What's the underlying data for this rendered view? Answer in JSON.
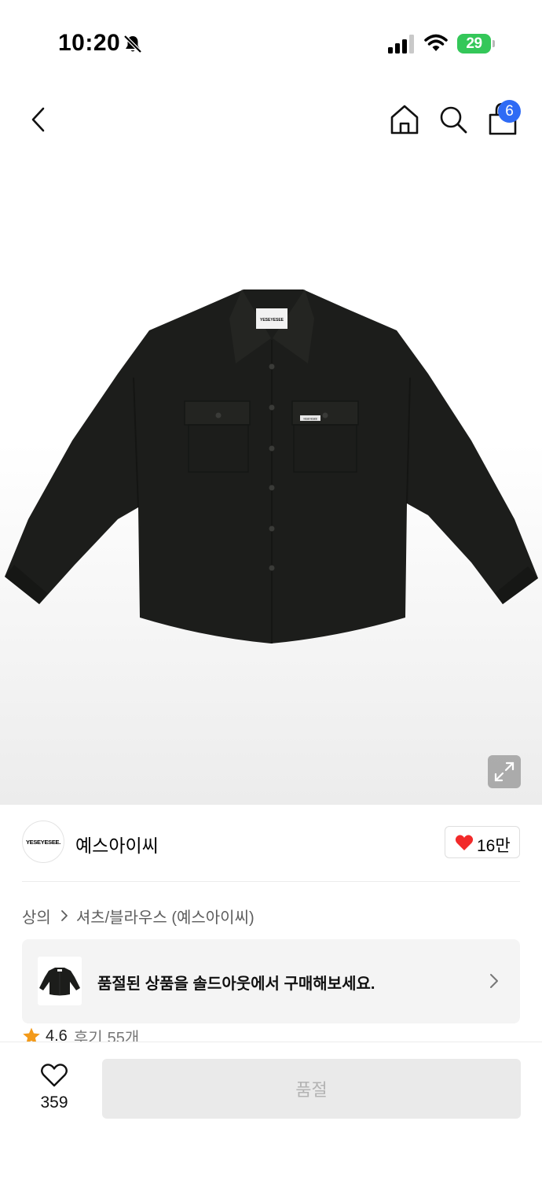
{
  "status_bar": {
    "time": "10:20",
    "battery": "29",
    "icons": [
      "bell-muted-icon",
      "signal-icon",
      "wifi-icon",
      "battery-charging-icon"
    ]
  },
  "top_nav": {
    "icons": [
      "back-chevron-icon",
      "home-icon",
      "search-icon",
      "bag-icon"
    ],
    "cart_badge": "6"
  },
  "product_image": {
    "collar_label": "YESEYESEE",
    "pocket_label": "YESEYESEE"
  },
  "brand": {
    "logo_text": "YESEYESEE.",
    "name": "예스아이씨",
    "like_count": "16만"
  },
  "breadcrumb": {
    "category": "상의",
    "subcategory": "셔츠/블라우스 (예스아이씨)"
  },
  "soldout_banner": {
    "text": "품절된 상품을 솔드아웃에서 구매해보세요."
  },
  "rating": {
    "score": "4.6",
    "review_label": "후기",
    "review_count": "55개"
  },
  "bottom_bar": {
    "wish_count": "359",
    "buy_label": "품절"
  },
  "colors": {
    "accent_blue": "#2f6bf5",
    "heart_red": "#f22a2a",
    "star_orange": "#f39a1a",
    "battery_green": "#34c759"
  }
}
